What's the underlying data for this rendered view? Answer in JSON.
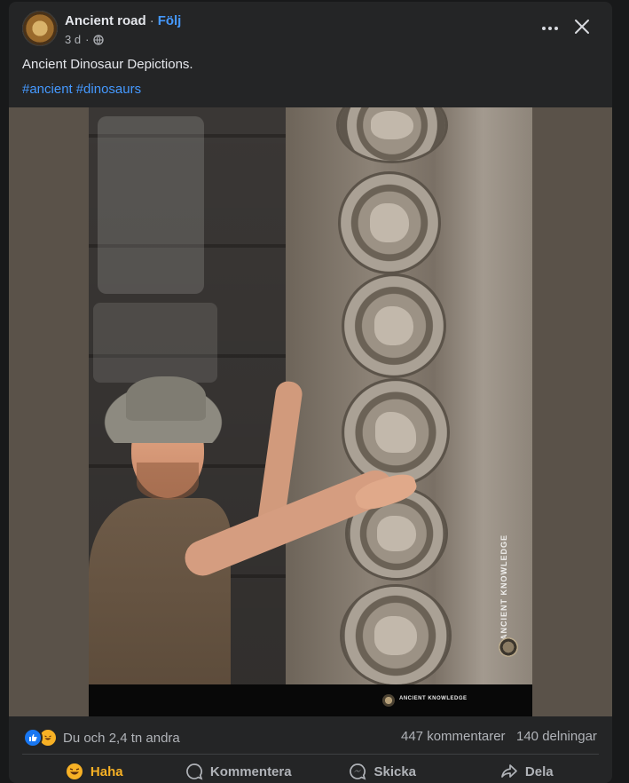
{
  "post": {
    "author": "Ancient road",
    "separator": "·",
    "follow_label": "Följ",
    "time": "3 d",
    "separator2": "·",
    "text": "Ancient Dinosaur Depictions.",
    "hashtags": [
      "#ancient",
      "#dinosaurs"
    ]
  },
  "image": {
    "watermark_side": "ANCIENT KNOWLEDGE",
    "watermark_footer": "ANCIENT KNOWLEDGE"
  },
  "stats": {
    "reactions_text": "Du och 2,4 tn andra",
    "comments": "447 kommentarer",
    "shares": "140 delningar"
  },
  "actions": {
    "reaction_label": "Haha",
    "comment_label": "Kommentera",
    "send_label": "Skicka",
    "share_label": "Dela"
  },
  "colors": {
    "background": "#18191a",
    "card": "#242526",
    "link": "#4599ff",
    "haha": "#f7b125",
    "like": "#1877f2"
  },
  "icons": [
    "globe-icon",
    "more-icon",
    "close-icon",
    "like-icon",
    "haha-icon",
    "comment-icon",
    "send-icon",
    "share-icon"
  ]
}
